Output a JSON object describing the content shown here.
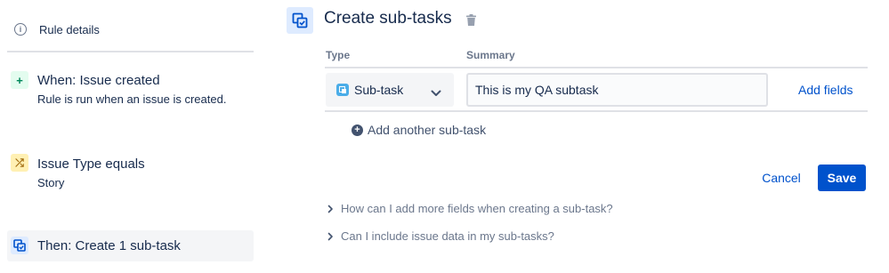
{
  "sidebar": {
    "rule_details": {
      "label": "Rule details",
      "icon": "info-icon",
      "badge_glyph": "i"
    },
    "trigger": {
      "icon": "plus-icon",
      "badge_glyph": "+",
      "title": "When: Issue created",
      "subtitle": "Rule is run when an issue is created."
    },
    "condition": {
      "icon": "shuffle-icon",
      "badge_glyph": "⤮",
      "title": "Issue Type equals",
      "subtitle": "Story"
    },
    "action": {
      "icon": "subtask-icon",
      "title": "Then: Create 1 sub-task",
      "selected": true
    }
  },
  "editor": {
    "title": "Create sub-tasks",
    "columns": {
      "type": "Type",
      "summary": "Summary"
    },
    "row": {
      "type_value": "Sub-task",
      "summary_value": "This is my QA subtask",
      "add_fields_label": "Add fields"
    },
    "add_another_label": "Add another sub-task",
    "add_another_glyph": "+",
    "cancel_label": "Cancel",
    "save_label": "Save",
    "faq": [
      {
        "label": "How can I add more fields when creating a sub-task?"
      },
      {
        "label": "Can I include issue data in my sub-tasks?"
      }
    ]
  },
  "colors": {
    "primary": "#0052cc",
    "text": "#172b4d",
    "muted": "#6b778c",
    "trigger_badge": "#e3fcef",
    "condition_badge": "#fff0b3",
    "action_badge": "#deebff",
    "subtask_icon": "#4bade8"
  }
}
